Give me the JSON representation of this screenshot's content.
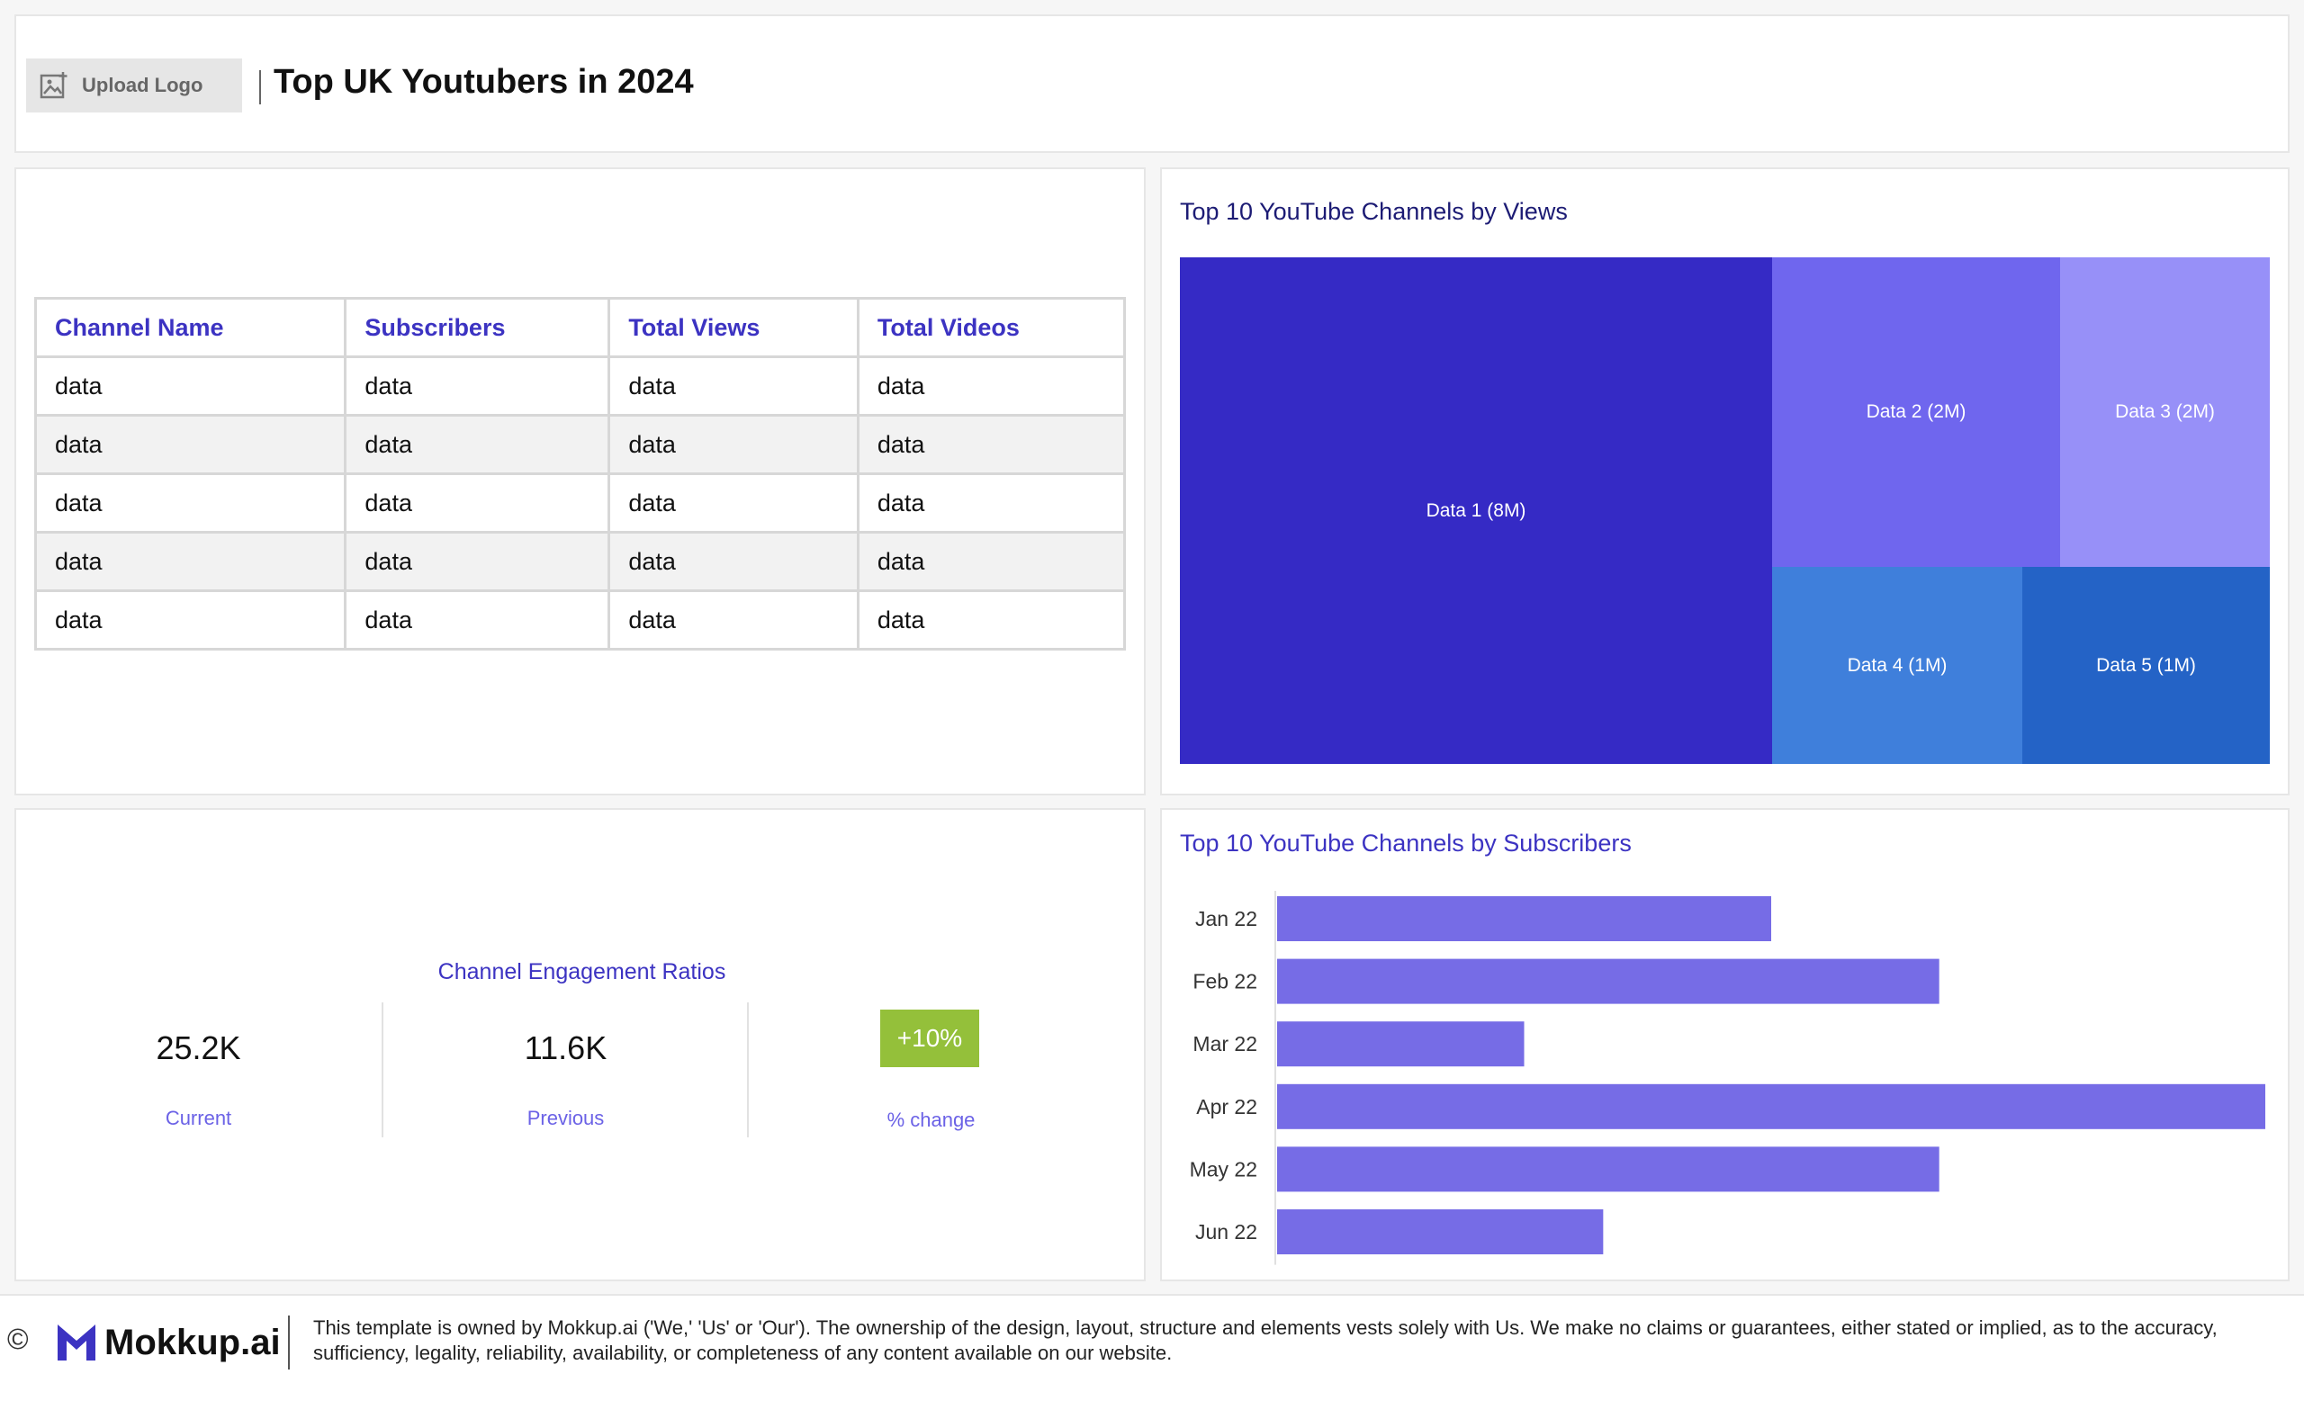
{
  "header": {
    "upload_logo_label": "Upload Logo",
    "title": "Top UK Youtubers in 2024"
  },
  "table": {
    "columns": [
      "Channel Name",
      "Subscribers",
      "Total Views",
      "Total Videos"
    ],
    "rows": [
      [
        "data",
        "data",
        "data",
        "data"
      ],
      [
        "data",
        "data",
        "data",
        "data"
      ],
      [
        "data",
        "data",
        "data",
        "data"
      ],
      [
        "data",
        "data",
        "data",
        "data"
      ],
      [
        "data",
        "data",
        "data",
        "data"
      ]
    ]
  },
  "treemap": {
    "title": "Top 10 YouTube Channels by Views",
    "items": [
      {
        "label": "Data 1 (8M)",
        "value": 8,
        "color": "#352ac5"
      },
      {
        "label": "Data 2 (2M)",
        "value": 2,
        "color": "#6f66ee"
      },
      {
        "label": "Data 3 (2M)",
        "value": 2,
        "color": "#9790f8"
      },
      {
        "label": "Data 4 (1M)",
        "value": 1,
        "color": "#3f7fdb"
      },
      {
        "label": "Data 5 (1M)",
        "value": 1,
        "color": "#2463c6"
      }
    ]
  },
  "engagement": {
    "title": "Channel Engagement Ratios",
    "current_value": "25.2K",
    "current_label": "Current",
    "previous_value": "11.6K",
    "previous_label": "Previous",
    "change_value": "+10%",
    "change_label": "% change",
    "change_color": "#94c03a"
  },
  "chart_data": {
    "type": "bar",
    "orientation": "horizontal",
    "title": "Top 10 YouTube Channels by Subscribers",
    "categories": [
      "Jan 22",
      "Feb 22",
      "Mar 22",
      "Apr 22",
      "May 22",
      "Jun 22"
    ],
    "values": [
      50,
      67,
      25,
      100,
      67,
      33
    ],
    "xlim": [
      0,
      100
    ],
    "bar_color": "#766ce6",
    "grid": false,
    "legend": "none"
  },
  "footer": {
    "copyright_symbol": "©",
    "brand": "Mokkup.ai",
    "disclaimer": "This template is owned by Mokkup.ai ('We,' 'Us' or 'Our'). The ownership of the design, layout, structure and elements vests solely with Us. We make no claims or guarantees, either stated or implied, as to the accuracy, sufficiency, legality, reliability, availability, or completeness of any content available on our website."
  }
}
